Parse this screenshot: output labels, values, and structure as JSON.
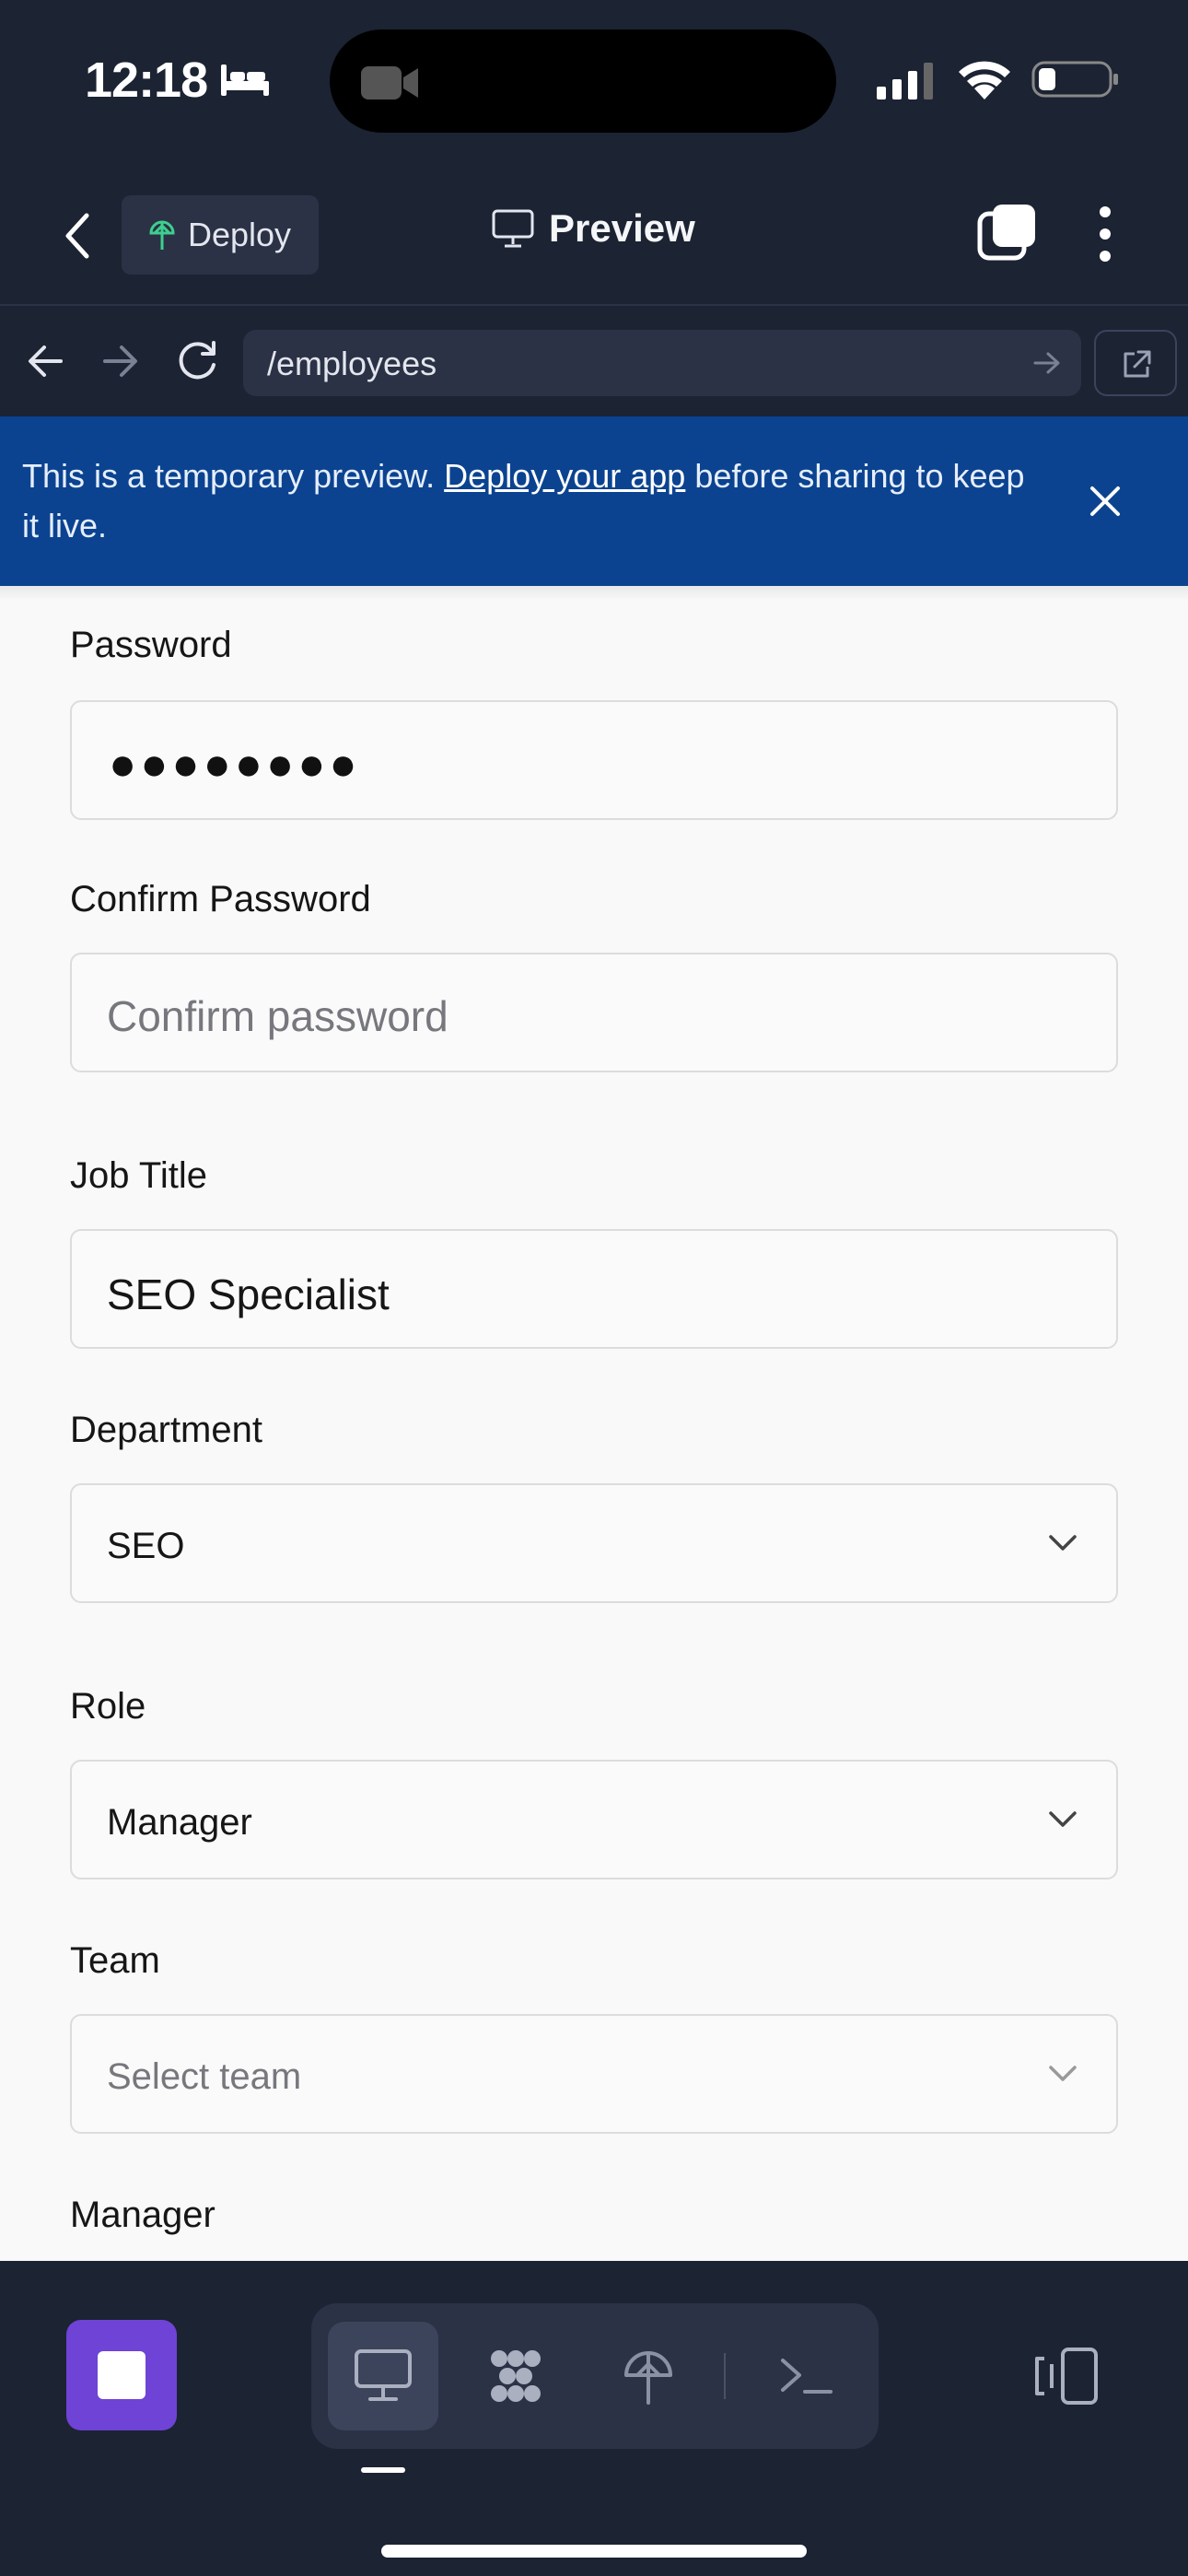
{
  "status_bar": {
    "time": "12:18",
    "icons": [
      "bed-icon",
      "camera-icon",
      "cellular-signal-icon",
      "wifi-icon",
      "battery-icon"
    ]
  },
  "app_header": {
    "deploy_label": "Deploy",
    "title": "Preview",
    "icons": [
      "back-icon",
      "deploy-icon",
      "monitor-icon",
      "tabs-icon",
      "more-vertical-icon"
    ]
  },
  "browser": {
    "url": "/employees",
    "icons": [
      "arrow-left-icon",
      "arrow-right-icon",
      "reload-icon",
      "arrow-right-icon",
      "external-link-icon"
    ]
  },
  "banner": {
    "text_before": "This is a temporary preview. ",
    "link_text": "Deploy your app",
    "text_after": " before sharing to keep it live."
  },
  "form": {
    "password": {
      "label": "Password",
      "masked_value": "●●●●●●●●"
    },
    "confirm_password": {
      "label": "Confirm Password",
      "placeholder": "Confirm password"
    },
    "job_title": {
      "label": "Job Title",
      "value": "SEO Specialist"
    },
    "department": {
      "label": "Department",
      "selected": "SEO"
    },
    "role": {
      "label": "Role",
      "selected": "Manager"
    },
    "team": {
      "label": "Team",
      "placeholder": "Select team"
    },
    "manager": {
      "label": "Manager"
    }
  },
  "dock": {
    "tools": [
      "monitor-icon",
      "workflow-icon",
      "deploy-icon",
      "terminal-icon"
    ],
    "active_tool": "monitor-icon",
    "accent": "#6e43d6"
  },
  "colors": {
    "chrome_bg": "#1c2333",
    "surface": "#2b3245",
    "banner_bg": "#0b4390",
    "page_bg": "#f9f9f9"
  }
}
